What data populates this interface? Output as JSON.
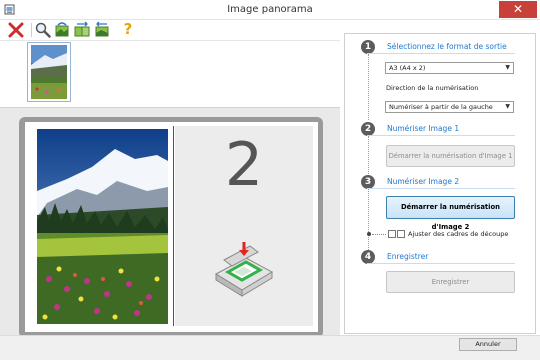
{
  "window": {
    "title": "Image panorama",
    "close_glyph": "✕"
  },
  "toolbar": {
    "items": [
      {
        "icon": "delete-icon"
      },
      {
        "icon": "zoom-icon"
      },
      {
        "icon": "rotate-icon"
      },
      {
        "icon": "swap-images-icon"
      },
      {
        "icon": "swap-direction-icon"
      },
      {
        "icon": "help-icon",
        "glyph": "?"
      }
    ]
  },
  "preview": {
    "current_image_number": "2"
  },
  "steps": [
    {
      "number": "1",
      "title": "Sélectionnez le format de sortie",
      "format_value": "A3 (A4 x 2)",
      "direction_label": "Direction de la numérisation",
      "direction_value": "Numériser à partir de la gauche"
    },
    {
      "number": "2",
      "title": "Numériser Image 1",
      "button": "Démarrer la numérisation d'Image 1"
    },
    {
      "number": "3",
      "title": "Numériser Image 2",
      "button": "Démarrer la numérisation d'Image 2",
      "crop_checkbox_label": "Ajuster des cadres de découpe"
    },
    {
      "number": "4",
      "title": "Enregistrer",
      "button": "Enregistrer"
    }
  ],
  "footer": {
    "cancel": "Annuler"
  },
  "colors": {
    "accent": "#1f78d1",
    "close": "#c7413a",
    "step_circle": "#5c5c5c"
  }
}
